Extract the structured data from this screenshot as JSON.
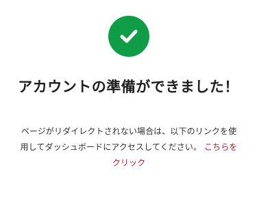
{
  "status": {
    "icon": "checkmark-icon",
    "color": "#0f9d47"
  },
  "title": "アカウントの準備ができました！",
  "message": {
    "text": "ページがリダイレクトされない場合は、以下のリンクを使用してダッシュボードにアクセスしてください。",
    "link_label": "こちらをクリック",
    "link_color": "#b01f2e"
  }
}
